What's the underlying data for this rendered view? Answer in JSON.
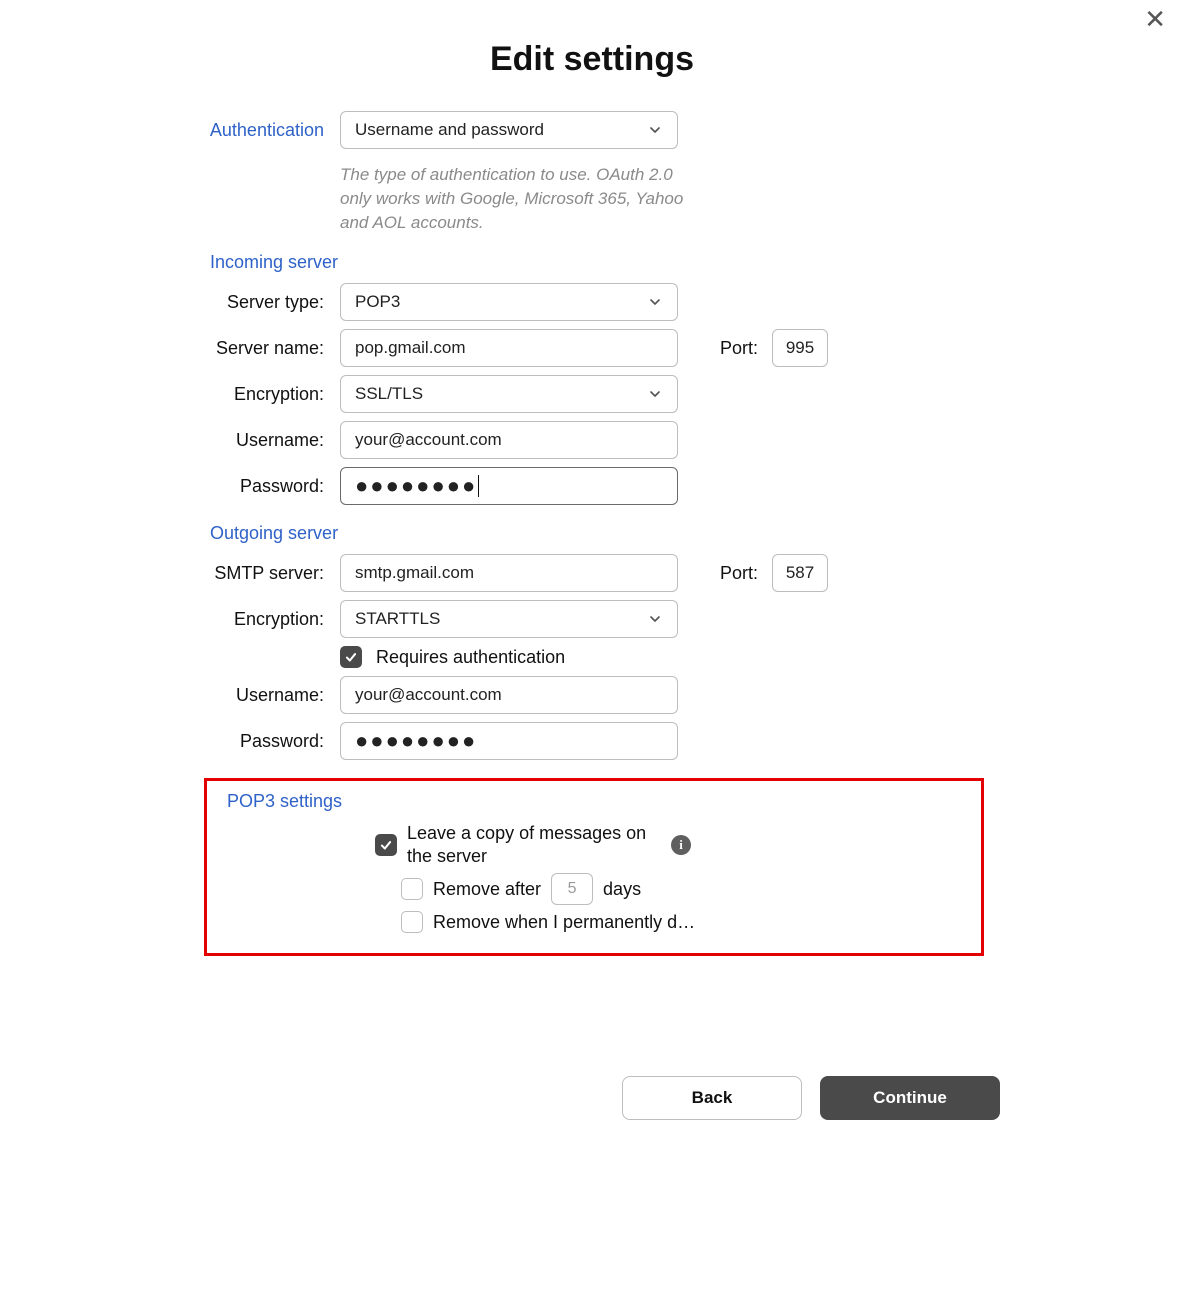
{
  "title": "Edit settings",
  "auth": {
    "label": "Authentication",
    "selected": "Username and password",
    "hint": "The type of authentication to use. OAuth 2.0 only works with Google, Microsoft 365, Yahoo and AOL accounts."
  },
  "incoming": {
    "section_label": "Incoming server",
    "server_type_label": "Server type:",
    "server_type_value": "POP3",
    "server_name_label": "Server name:",
    "server_name_value": "pop.gmail.com",
    "port_label": "Port:",
    "port_value": "995",
    "encryption_label": "Encryption:",
    "encryption_value": "SSL/TLS",
    "username_label": "Username:",
    "username_value": "your@account.com",
    "password_label": "Password:",
    "password_value": "●●●●●●●●"
  },
  "outgoing": {
    "section_label": "Outgoing server",
    "server_label": "SMTP server:",
    "server_value": "smtp.gmail.com",
    "port_label": "Port:",
    "port_value": "587",
    "encryption_label": "Encryption:",
    "encryption_value": "STARTTLS",
    "requires_auth_label": "Requires authentication",
    "username_label": "Username:",
    "username_value": "your@account.com",
    "password_label": "Password:",
    "password_value": "●●●●●●●●"
  },
  "pop3": {
    "section_label": "POP3 settings",
    "leave_copy_label": "Leave a copy of messages on the server",
    "remove_after_prefix": "Remove after",
    "remove_after_days": "5",
    "remove_after_suffix": "days",
    "remove_when_delete_label": "Remove when I permanently delete them from the 'Deleted Items' folder"
  },
  "buttons": {
    "back": "Back",
    "continue": "Continue"
  }
}
